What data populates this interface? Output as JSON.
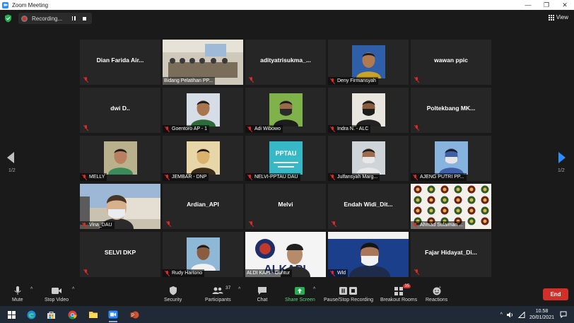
{
  "window": {
    "title": "Zoom Meeting",
    "minimize": "—",
    "restore": "❐",
    "close": "✕"
  },
  "topbar": {
    "recording_label": "Recording...",
    "view_label": "View"
  },
  "navigation": {
    "page_left": "1/2",
    "page_right": "1/2"
  },
  "tiles": [
    {
      "type": "name",
      "name": "Dian Farida Air...",
      "muted": true
    },
    {
      "type": "room",
      "caption": "Bidang Pelatihan PP...",
      "muted": false
    },
    {
      "type": "name",
      "name": "adityatrisukma_...",
      "muted": true
    },
    {
      "type": "portrait",
      "caption": "Deny Firmansyah",
      "muted": true,
      "bg": "#2f5fa8",
      "skin": "#b07a50",
      "shirt": "#c9a227"
    },
    {
      "type": "name",
      "name": "wawan ppic",
      "muted": true
    },
    {
      "type": "name",
      "name": "dwi D..",
      "muted": true
    },
    {
      "type": "portrait",
      "caption": "Goentoro AP - 1",
      "muted": true,
      "bg": "#d7dde6",
      "skin": "#a8764e",
      "shirt": "#2e6b3a"
    },
    {
      "type": "portrait",
      "caption": "Adi Wibowo",
      "muted": true,
      "bg": "#7fb24a",
      "skin": "#9a6b48",
      "shirt": "#1c1c1c",
      "mask": "#2a2a2a"
    },
    {
      "type": "portrait",
      "caption": "Indra N. - ALC",
      "muted": true,
      "bg": "#e9e6df",
      "skin": "#8a5d3f",
      "shirt": "#222222",
      "mask": "#1d1d1d"
    },
    {
      "type": "name",
      "name": "Poltekbang  MK...",
      "muted": true
    },
    {
      "type": "portrait",
      "caption": "MELLY",
      "muted": true,
      "bg": "#b9b08c",
      "skin": "#b88060",
      "shirt": "#3b8a5a"
    },
    {
      "type": "portrait",
      "caption": "JEMBAR - DNP",
      "muted": true,
      "bg": "#e7d6a8",
      "skin": "#d9b36d",
      "shirt": "#3a2b1a"
    },
    {
      "type": "logo",
      "caption": "NELVI-PPTAU DAU",
      "muted": true,
      "text": "PPTAU",
      "bg": "#36b8c6"
    },
    {
      "type": "portrait",
      "caption": "Julfansyah Marg...",
      "muted": true,
      "bg": "#cfd4d8",
      "skin": "#9b6d4c",
      "shirt": "#e8e8e8",
      "mask": "#e8e8e8"
    },
    {
      "type": "portrait",
      "caption": "AJENG PUTRI PP...",
      "muted": true,
      "bg": "#87b4de",
      "skin": "#3f5fa8",
      "shirt": "#3f5fa8",
      "mask": "#e6e6e6"
    },
    {
      "type": "wide",
      "caption": "Vina_DAU",
      "muted": true
    },
    {
      "type": "name",
      "name": "Ardian_API",
      "muted": true
    },
    {
      "type": "name",
      "name": "Melvi",
      "muted": true
    },
    {
      "type": "name",
      "name": "Endah  Widi_Dit...",
      "muted": true
    },
    {
      "type": "pattern",
      "caption": "Ahmad Sulaiman ...",
      "muted": true
    },
    {
      "type": "name",
      "name": "SELVI DKP",
      "muted": true
    },
    {
      "type": "portrait",
      "caption": "Rudy Hartono",
      "muted": true,
      "bg": "#8fb8d6",
      "skin": "#8a5d3f",
      "shirt": "#f1f1f1"
    },
    {
      "type": "speaker",
      "caption": "ALDI KAPI - Guntur",
      "muted": false,
      "active": true,
      "watermark": "ALKAPI"
    },
    {
      "type": "speaker2",
      "caption": "Wld",
      "muted": true
    },
    {
      "type": "name",
      "name": "Fajar  Hidayat_Di...",
      "muted": true
    }
  ],
  "toolbar": {
    "mute": "Mute",
    "stop_video": "Stop Video",
    "security": "Security",
    "participants": "Participants",
    "participants_count": "37",
    "chat": "Chat",
    "share_screen": "Share Screen",
    "pause_recording": "Pause/Stop Recording",
    "breakout_rooms": "Breakout Rooms",
    "breakout_count": "35",
    "reactions": "Reactions",
    "end": "End"
  },
  "taskbar": {
    "time": "10.58",
    "date": "20/01/2021"
  },
  "colors": {
    "accent": "#2d8cff",
    "active_speaker": "#f2d21d",
    "muted_icon": "#e02828",
    "end": "#d0302a",
    "share": "#23b14d"
  }
}
